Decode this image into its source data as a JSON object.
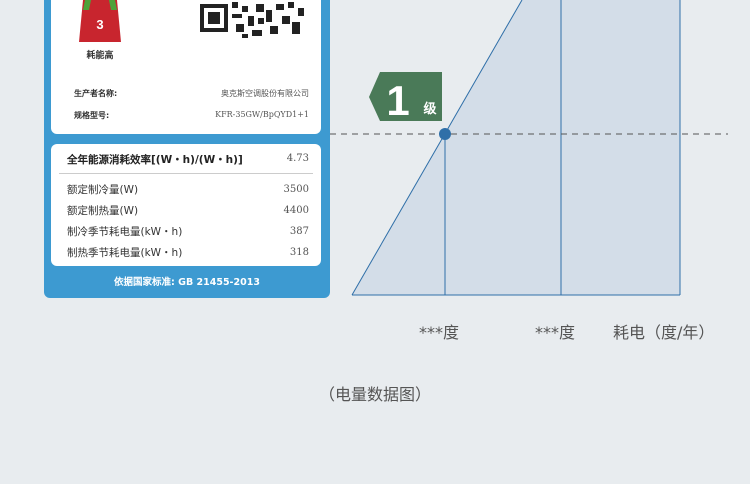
{
  "energy_label": {
    "grade_number": "3",
    "grade_text": "耗能高",
    "manufacturer_label": "生产者名称:",
    "manufacturer_value": "奥克斯空调股份有限公司",
    "model_label": "规格型号:",
    "model_value": "KFR-35GW/BpQYD1+1",
    "efficiency_title": "全年能源消耗效率[(W・h)/(W・h)]",
    "efficiency_value": "4.73",
    "specs": [
      {
        "label": "额定制冷量(W)",
        "value": "3500"
      },
      {
        "label": "额定制热量(W)",
        "value": "4400"
      },
      {
        "label": "制冷季节耗电量(kW・h)",
        "value": "387"
      },
      {
        "label": "制热季节耗电量(kW・h)",
        "value": "318"
      }
    ],
    "footer": "依据国家标准: GB 21455-2013"
  },
  "diagram": {
    "level_number": "1",
    "level_suffix": "级",
    "axis_labels": [
      "***度",
      "***度",
      "耗电（度/年）"
    ],
    "fill_color": "#d3dde8",
    "line_color": "#2f6fa8"
  },
  "caption": "（电量数据图）",
  "colors": {
    "label_blue": "#3d9ad1",
    "grade_red": "#c8252e",
    "grade_green": "#4fa23a",
    "badge_green": "#4a7a58",
    "background": "#e8ecef"
  },
  "icons": [
    "qr-code-icon",
    "energy-grade-icon",
    "level-badge-icon"
  ]
}
